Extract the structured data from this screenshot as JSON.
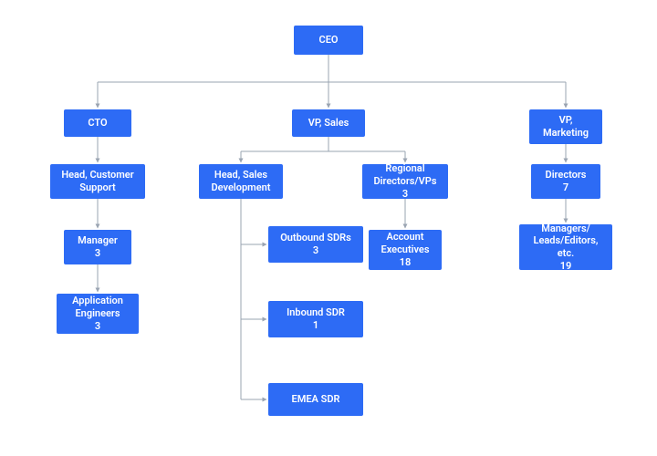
{
  "colors": {
    "node_bg": "#2d6bf5",
    "node_fg": "#ffffff",
    "connector": "#9aa4b2"
  },
  "nodes": {
    "ceo": {
      "label": "CEO"
    },
    "cto": {
      "label": "CTO"
    },
    "vp_sales": {
      "label": "VP, Sales"
    },
    "vp_marketing": {
      "label": "VP, Marketing"
    },
    "head_support": {
      "label": "Head, Customer Support"
    },
    "manager": {
      "label": "Manager",
      "count": "3"
    },
    "app_eng": {
      "label": "Application Engineers",
      "count": "3"
    },
    "head_salesdev": {
      "label": "Head, Sales Development"
    },
    "regional": {
      "label": "Regional Directors/VPs",
      "count": "3"
    },
    "outbound": {
      "label": "Outbound SDRs",
      "count": "3"
    },
    "inbound": {
      "label": "Inbound SDR",
      "count": "1"
    },
    "emea": {
      "label": "EMEA SDR"
    },
    "ae": {
      "label": "Account Executives",
      "count": "18"
    },
    "directors": {
      "label": "Directors",
      "count": "7"
    },
    "managers_leads": {
      "label": "Managers/ Leads/Editors, etc.",
      "count": "19"
    }
  }
}
